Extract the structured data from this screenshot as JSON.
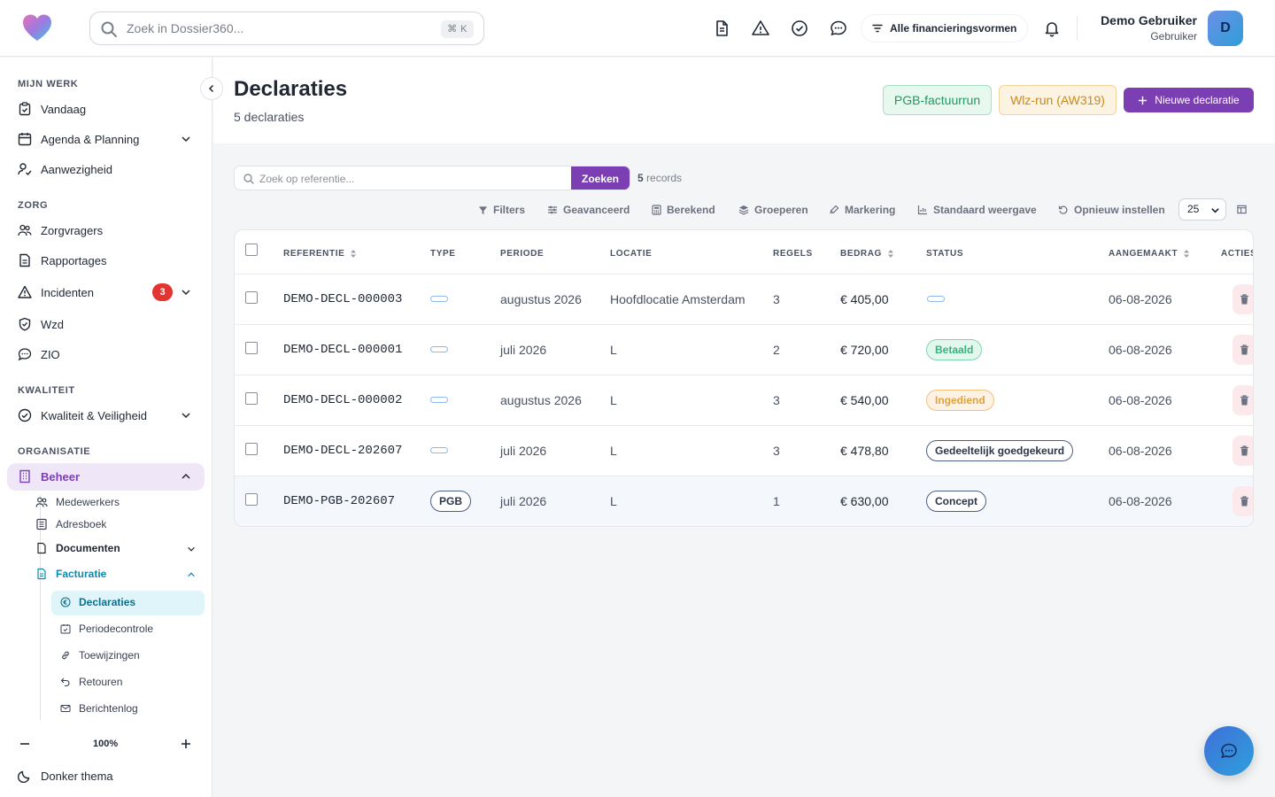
{
  "topbar": {
    "search_placeholder": "Zoek in Dossier360...",
    "shortcut": "⌘ K",
    "financing_filter": "Alle financieringsvormen",
    "user_name": "Demo Gebruiker",
    "user_role": "Gebruiker",
    "avatar_initial": "D"
  },
  "sidebar": {
    "section_mijn_werk": "MIJN WERK",
    "vandaag": "Vandaag",
    "agenda": "Agenda & Planning",
    "aanwezigheid": "Aanwezigheid",
    "section_zorg": "ZORG",
    "zorgvragers": "Zorgvragers",
    "rapportages": "Rapportages",
    "incidenten": "Incidenten",
    "incidenten_count": "3",
    "wzd": "Wzd",
    "zio": "ZIO",
    "section_kwaliteit": "KWALITEIT",
    "kwaliteit": "Kwaliteit & Veiligheid",
    "section_organisatie": "ORGANISATIE",
    "beheer": "Beheer",
    "medewerkers": "Medewerkers",
    "adresboek": "Adresboek",
    "documenten": "Documenten",
    "facturatie": "Facturatie",
    "declaraties": "Declaraties",
    "periodecontrole": "Periodecontrole",
    "toewijzingen": "Toewijzingen",
    "retouren": "Retouren",
    "berichtenlog": "Berichtenlog",
    "zoom": "100%",
    "theme": "Donker thema"
  },
  "header": {
    "title": "Declaraties",
    "subtitle": "5 declaraties",
    "pgb_button": "PGB-factuurrun",
    "wlz_button": "Wlz-run (AW319)",
    "new_button": "Nieuwe declaratie"
  },
  "toolbar": {
    "search_placeholder": "Zoek op referentie...",
    "search_button": "Zoeken",
    "records_count": "5",
    "records_label": "records",
    "filters": "Filters",
    "advanced": "Geavanceerd",
    "computed": "Berekend",
    "group": "Groeperen",
    "marking": "Markering",
    "view": "Standaard weergave",
    "reset": "Opnieuw instellen",
    "per_page": "25"
  },
  "table": {
    "headers": {
      "reference": "REFERENTIE",
      "type": "TYPE",
      "period": "PERIODE",
      "location": "LOCATIE",
      "lines": "REGELS",
      "amount": "BEDRAG",
      "status": "STATUS",
      "created": "AANGEMAAKT",
      "actions": "ACTIES"
    },
    "rows": [
      {
        "reference": "DEMO-DECL-000003",
        "type": "",
        "period": "augustus 2026",
        "location": "Hoofdlocatie Amsterdam",
        "lines": "3",
        "amount": "€ 405,00",
        "status": "",
        "created": "06-08-2026"
      },
      {
        "reference": "DEMO-DECL-000001",
        "type": "",
        "period": "juli 2026",
        "location": "L",
        "lines": "2",
        "amount": "€ 720,00",
        "status": "Betaald",
        "created": "06-08-2026"
      },
      {
        "reference": "DEMO-DECL-000002",
        "type": "",
        "period": "augustus 2026",
        "location": "L",
        "lines": "3",
        "amount": "€ 540,00",
        "status": "Ingediend",
        "created": "06-08-2026"
      },
      {
        "reference": "DEMO-DECL-202607",
        "type": "",
        "period": "juli 2026",
        "location": "L",
        "lines": "3",
        "amount": "€ 478,80",
        "status": "Gedeeltelijk goedgekeurd",
        "created": "06-08-2026"
      },
      {
        "reference": "DEMO-PGB-202607",
        "type": "PGB",
        "period": "juli 2026",
        "location": "L",
        "lines": "1",
        "amount": "€ 630,00",
        "status": "Concept",
        "created": "06-08-2026"
      }
    ]
  },
  "colors": {
    "brand": "#7b3fb3",
    "active_teal": "#0e8aa8",
    "paid": "#1f9a5e",
    "submitted": "#c98a17",
    "danger": "#e3342f"
  }
}
